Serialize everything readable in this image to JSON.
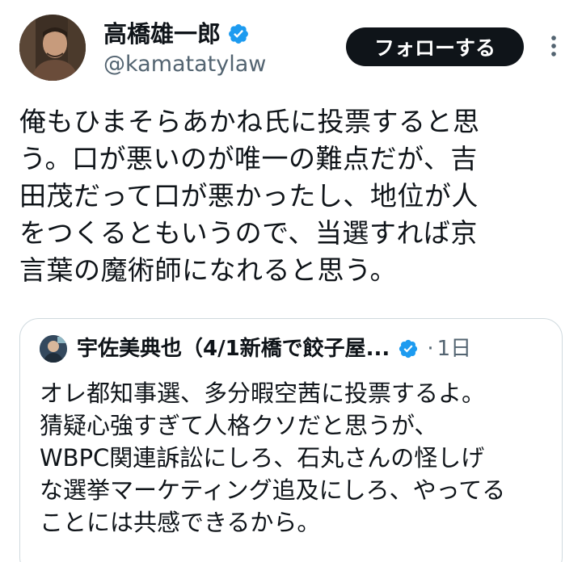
{
  "author": {
    "display_name": "高橋雄一郎",
    "handle": "@kamatatylaw",
    "verified": true
  },
  "actions": {
    "follow_label": "フォローする"
  },
  "tweet": {
    "lines": [
      "俺もひまそらあかね氏に投票すると思",
      "う。口が悪いのが唯一の難点だが、吉",
      "田茂だって口が悪かったし、地位が人",
      "をつくるともいうので、当選すれば京",
      "言葉の魔術師になれると思う。"
    ]
  },
  "quote": {
    "display_name": "宇佐美典也（4/1新橋で餃子屋...",
    "verified": true,
    "separator": "·",
    "time": "1日",
    "lines": [
      "オレ都知事選、多分暇空茜に投票するよ。",
      "猜疑心強すぎて人格クソだと思うが、",
      "WBPC関連訴訟にしろ、石丸さんの怪しげ",
      "な選挙マーケティング追及にしろ、やってる",
      "ことには共感できるから。"
    ]
  },
  "colors": {
    "verified": "#1d9bf0",
    "secondary_text": "#536471",
    "follow_bg": "#0f1419",
    "border": "#cfd9de"
  },
  "icons": {
    "verified": "verified-badge-icon",
    "more": "more-options-icon"
  }
}
